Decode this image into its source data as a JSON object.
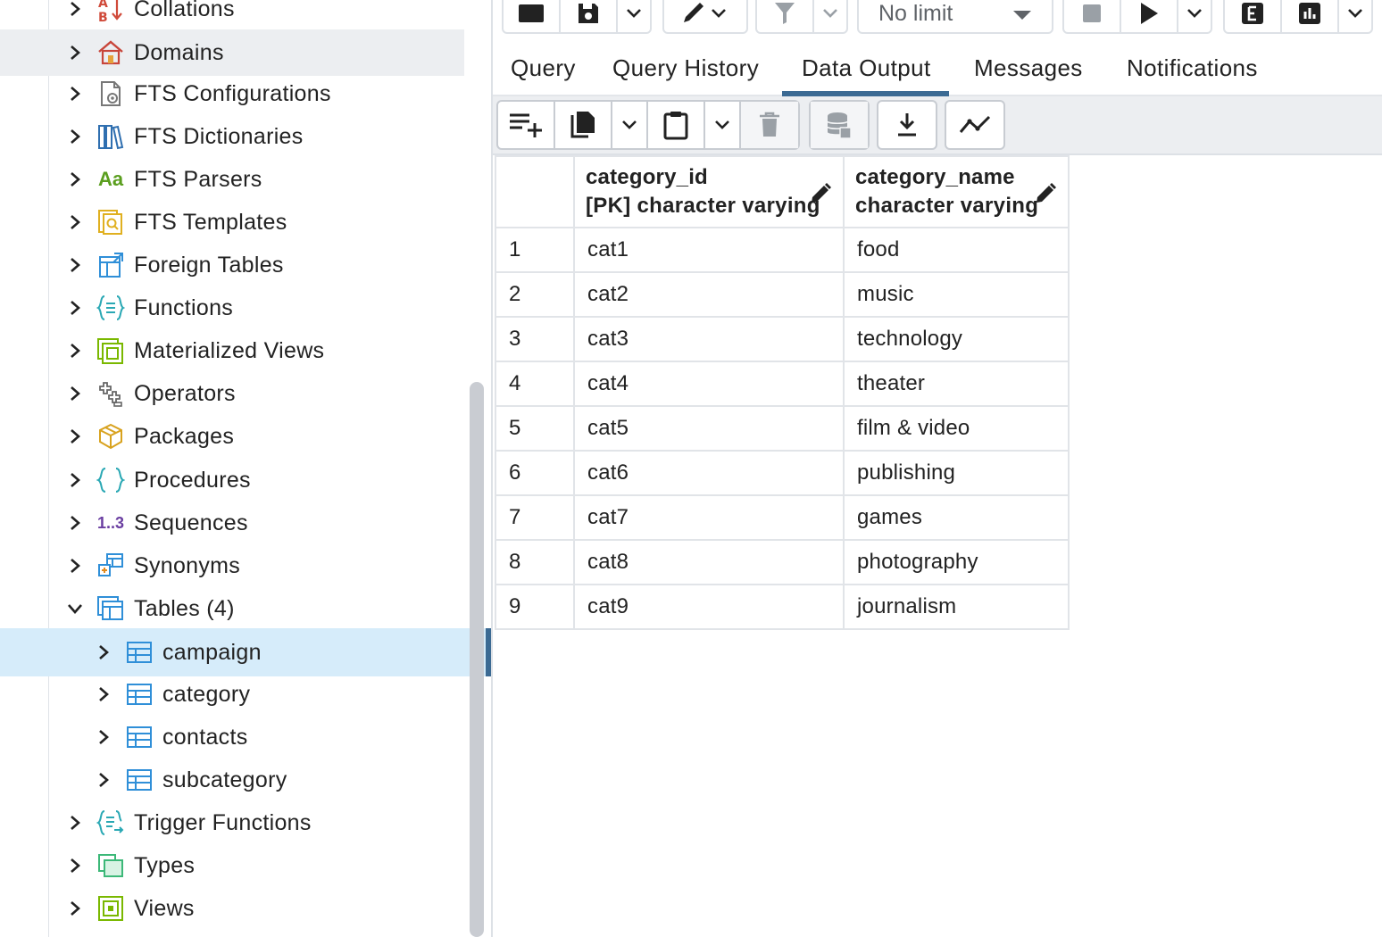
{
  "tree": {
    "items": [
      {
        "label": "Collations",
        "icon": "collations-icon",
        "expanded": false
      },
      {
        "label": "Domains",
        "icon": "domains-icon",
        "expanded": false
      },
      {
        "label": "FTS Configurations",
        "icon": "fts-configurations-icon",
        "expanded": false
      },
      {
        "label": "FTS Dictionaries",
        "icon": "fts-dictionaries-icon",
        "expanded": false
      },
      {
        "label": "FTS Parsers",
        "icon": "fts-parsers-icon",
        "icon_text": "Aa",
        "expanded": false
      },
      {
        "label": "FTS Templates",
        "icon": "fts-templates-icon",
        "expanded": false
      },
      {
        "label": "Foreign Tables",
        "icon": "foreign-tables-icon",
        "expanded": false
      },
      {
        "label": "Functions",
        "icon": "functions-icon",
        "expanded": false
      },
      {
        "label": "Materialized Views",
        "icon": "materialized-views-icon",
        "expanded": false
      },
      {
        "label": "Operators",
        "icon": "operators-icon",
        "expanded": false
      },
      {
        "label": "Packages",
        "icon": "packages-icon",
        "expanded": false
      },
      {
        "label": "Procedures",
        "icon": "procedures-icon",
        "expanded": false
      },
      {
        "label": "Sequences",
        "icon": "sequences-icon",
        "icon_text": "1..3",
        "expanded": false
      },
      {
        "label": "Synonyms",
        "icon": "synonyms-icon",
        "expanded": false
      },
      {
        "label": "Tables (4)",
        "icon": "tables-icon",
        "expanded": true
      },
      {
        "label": "Trigger Functions",
        "icon": "trigger-functions-icon",
        "expanded": false
      },
      {
        "label": "Types",
        "icon": "types-icon",
        "expanded": false
      },
      {
        "label": "Views",
        "icon": "views-icon",
        "expanded": false
      }
    ],
    "tables": [
      {
        "label": "campaign",
        "selected": true
      },
      {
        "label": "category",
        "selected": false
      },
      {
        "label": "contacts",
        "selected": false
      },
      {
        "label": "subcategory",
        "selected": false
      }
    ]
  },
  "query_toolbar": {
    "limit_label": "No limit"
  },
  "tabs": [
    {
      "label": "Query",
      "active": false
    },
    {
      "label": "Query History",
      "active": false
    },
    {
      "label": "Data Output",
      "active": true
    },
    {
      "label": "Messages",
      "active": false
    },
    {
      "label": "Notifications",
      "active": false
    }
  ],
  "grid": {
    "columns": [
      {
        "name": "category_id",
        "type": "[PK] character varying"
      },
      {
        "name": "category_name",
        "type": "character varying"
      }
    ],
    "rows": [
      {
        "num": "1",
        "category_id": "cat1",
        "category_name": "food"
      },
      {
        "num": "2",
        "category_id": "cat2",
        "category_name": "music"
      },
      {
        "num": "3",
        "category_id": "cat3",
        "category_name": "technology"
      },
      {
        "num": "4",
        "category_id": "cat4",
        "category_name": "theater"
      },
      {
        "num": "5",
        "category_id": "cat5",
        "category_name": "film & video"
      },
      {
        "num": "6",
        "category_id": "cat6",
        "category_name": "publishing"
      },
      {
        "num": "7",
        "category_id": "cat7",
        "category_name": "games"
      },
      {
        "num": "8",
        "category_id": "cat8",
        "category_name": "photography"
      },
      {
        "num": "9",
        "category_id": "cat9",
        "category_name": "journalism"
      }
    ]
  },
  "colors": {
    "accent": "#3b6a93",
    "selected_row": "#d6ecfa",
    "hover_row": "#eceef1"
  }
}
